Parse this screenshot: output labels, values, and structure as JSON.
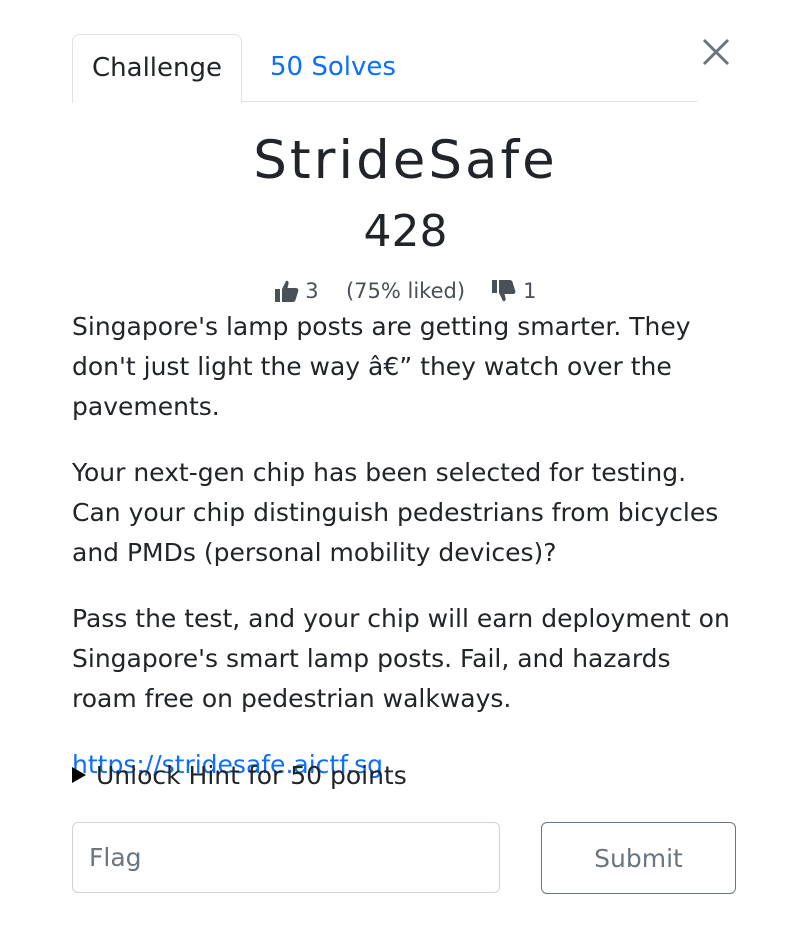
{
  "tabs": {
    "challenge_label": "Challenge",
    "solves_label": "50 Solves"
  },
  "challenge": {
    "name": "StrideSafe",
    "points": "428",
    "likes": "3",
    "liked_percent": "(75% liked)",
    "dislikes": "1",
    "description": [
      "Singapore's lamp posts are getting smarter. They don't just light the way â€” they watch over the pavements.",
      "Your next-gen chip has been selected for testing. Can your chip distinguish pedestrians from bicycles and PMDs (personal mobility devices)?",
      "Pass the test, and your chip will earn deployment on Singapore's smart lamp posts. Fail, and hazards roam free on pedestrian walkways."
    ],
    "link": "https://stridesafe.aictf.sg",
    "hint_label": "Unlock Hint for 50 points"
  },
  "form": {
    "flag_placeholder": "Flag",
    "submit_label": "Submit"
  },
  "icons": {
    "close": "close-icon",
    "thumbs_up": "thumbs-up-icon",
    "thumbs_down": "thumbs-down-icon",
    "hint_toggle": "triangle-right-icon"
  },
  "colors": {
    "link": "#0d6efd",
    "text": "#212529",
    "muted": "#6c757d"
  }
}
